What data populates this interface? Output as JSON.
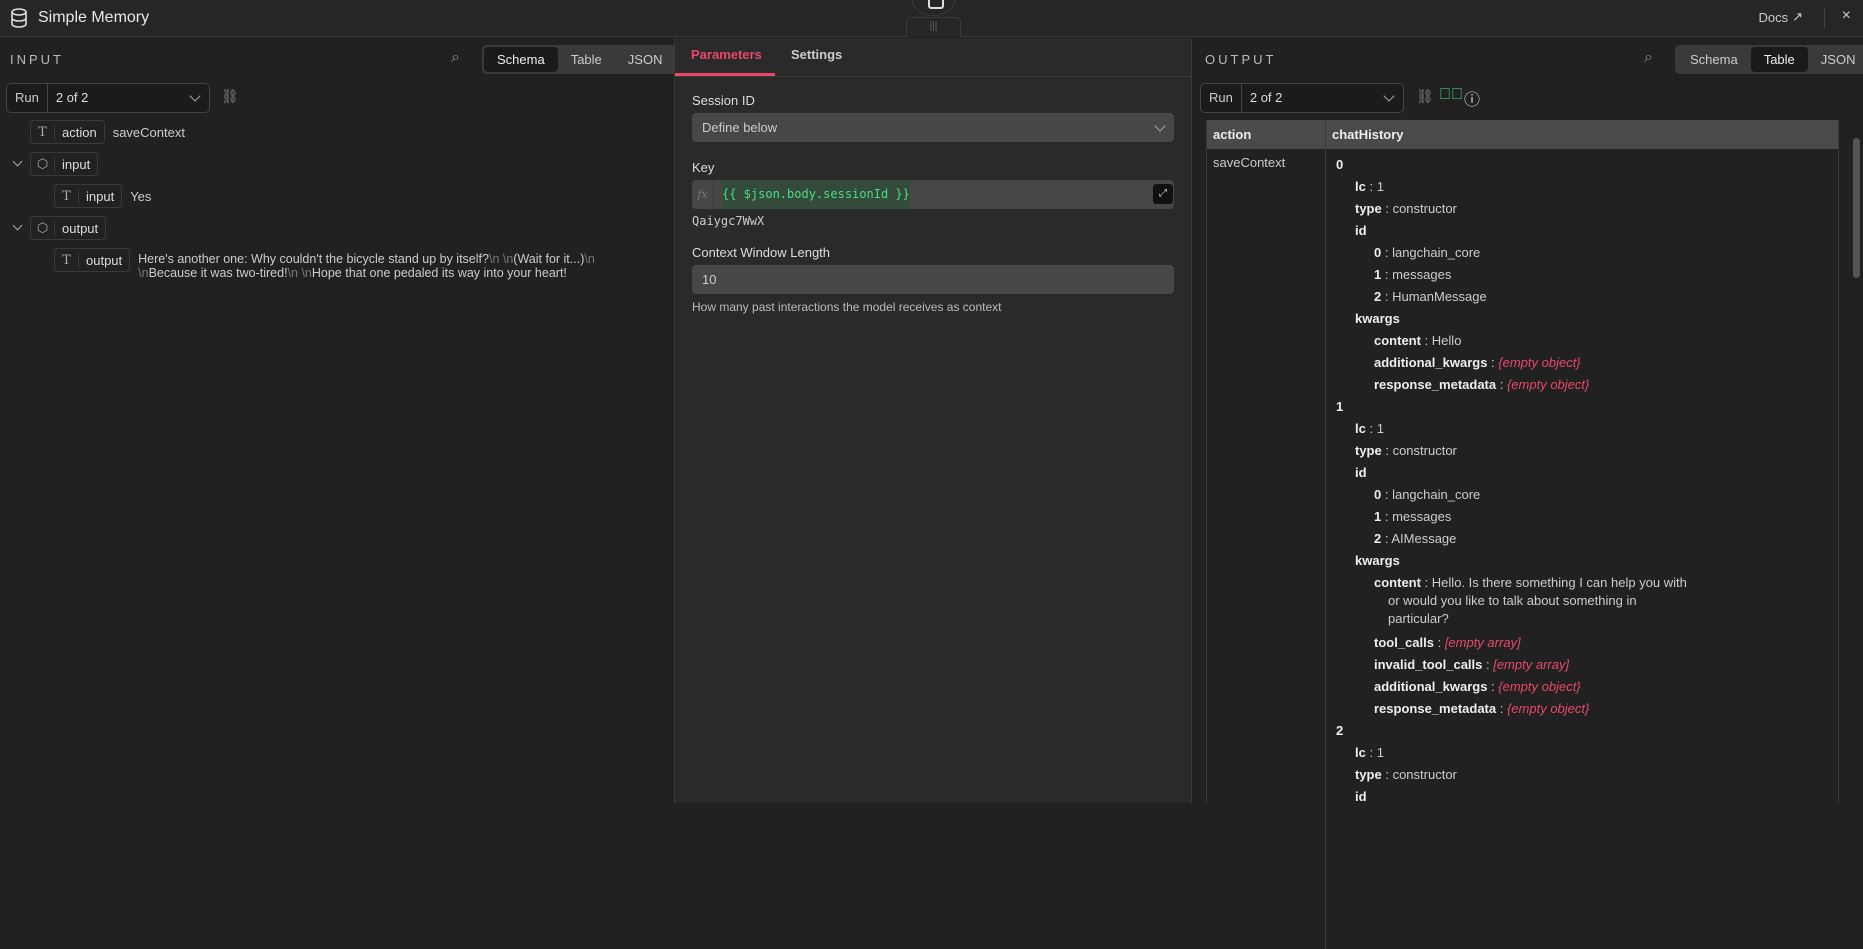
{
  "header": {
    "title": "Simple Memory",
    "docs": "Docs",
    "close": "×",
    "handle": "|||"
  },
  "input": {
    "label": "INPUT",
    "tabs": [
      "Schema",
      "Table",
      "JSON"
    ],
    "active_tab": "Schema",
    "run_label": "Run",
    "run_value": "2 of 2",
    "tree": [
      {
        "type": "T",
        "name": "action",
        "value": "saveContext"
      },
      {
        "type": "obj",
        "name": "input"
      },
      {
        "type": "T",
        "name": "input",
        "value": "Yes"
      },
      {
        "type": "obj",
        "name": "output"
      },
      {
        "type": "T",
        "name": "output",
        "value_parts": [
          "Here's another one: Why couldn't the bicycle stand up by itself?",
          "\\n \\n",
          "(Wait for it...)",
          "\\n \\n",
          "Because it was two-tired!",
          "\\n \\n",
          "Hope that one pedaled its way into your heart!"
        ]
      }
    ]
  },
  "params": {
    "tabs": [
      "Parameters",
      "Settings"
    ],
    "active_tab": "Parameters",
    "session_label": "Session ID",
    "session_value": "Define below",
    "key_label": "Key",
    "key_expr": "{{ $json.body.sessionId }}",
    "key_result": "Qaiygc7WwX",
    "context_label": "Context Window Length",
    "context_value": "10",
    "context_hint": "How many past interactions the model receives as context"
  },
  "output": {
    "label": "OUTPUT",
    "tabs": [
      "Schema",
      "Table",
      "JSON"
    ],
    "active_tab": "Table",
    "run_label": "Run",
    "run_value": "2 of 2",
    "columns": [
      "action",
      "chatHistory"
    ],
    "action_value": "saveContext",
    "lines": [
      {
        "l": 0,
        "k": "0"
      },
      {
        "l": 1,
        "k": "lc",
        "v": "1"
      },
      {
        "l": 1,
        "k": "type",
        "v": "constructor"
      },
      {
        "l": 1,
        "k": "id"
      },
      {
        "l": 2,
        "k": "0",
        "v": "langchain_core"
      },
      {
        "l": 2,
        "k": "1",
        "v": "messages"
      },
      {
        "l": 2,
        "k": "2",
        "v": "HumanMessage"
      },
      {
        "l": 1,
        "k": "kwargs"
      },
      {
        "l": 2,
        "k": "content",
        "v": "Hello"
      },
      {
        "l": 2,
        "k": "additional_kwargs",
        "e": "{empty object}"
      },
      {
        "l": 2,
        "k": "response_metadata",
        "e": "{empty object}"
      },
      {
        "l": 0,
        "k": "1"
      },
      {
        "l": 1,
        "k": "lc",
        "v": "1"
      },
      {
        "l": 1,
        "k": "type",
        "v": "constructor"
      },
      {
        "l": 1,
        "k": "id"
      },
      {
        "l": 2,
        "k": "0",
        "v": "langchain_core"
      },
      {
        "l": 2,
        "k": "1",
        "v": "messages"
      },
      {
        "l": 2,
        "k": "2",
        "v": "AIMessage"
      },
      {
        "l": 1,
        "k": "kwargs"
      },
      {
        "l": 2,
        "k": "content",
        "v": "Hello. Is there something I can help you with or would you like to talk about something in particular?"
      },
      {
        "l": 2,
        "k": "tool_calls",
        "e": "[empty array]"
      },
      {
        "l": 2,
        "k": "invalid_tool_calls",
        "e": "[empty array]"
      },
      {
        "l": 2,
        "k": "additional_kwargs",
        "e": "{empty object}"
      },
      {
        "l": 2,
        "k": "response_metadata",
        "e": "{empty object}"
      },
      {
        "l": 0,
        "k": "2"
      },
      {
        "l": 1,
        "k": "lc",
        "v": "1"
      },
      {
        "l": 1,
        "k": "type",
        "v": "constructor"
      },
      {
        "l": 1,
        "k": "id"
      }
    ]
  },
  "colors": {
    "accent": "#e9486a",
    "success": "#3fbf7f",
    "code": "#4ade80"
  }
}
